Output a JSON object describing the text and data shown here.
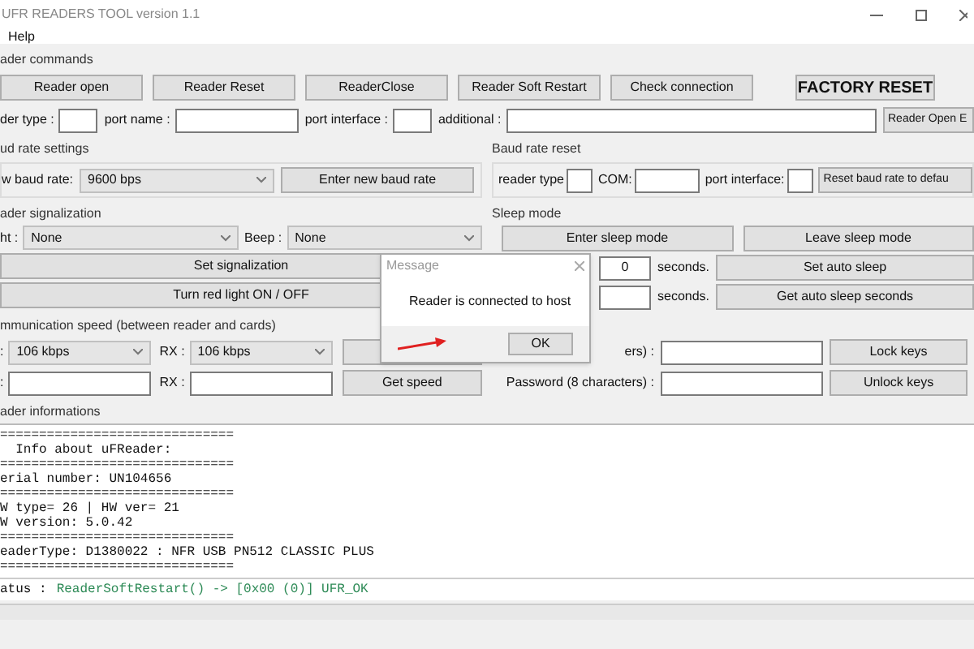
{
  "window": {
    "title": "UFR READERS TOOL version 1.1"
  },
  "menu": [
    "Help"
  ],
  "reader_commands": {
    "title": "ader commands",
    "buttons": [
      {
        "label": "Reader open",
        "kind": "normal"
      },
      {
        "label": "Reader Reset",
        "kind": "normal"
      },
      {
        "label": "ReaderClose",
        "kind": "normal"
      },
      {
        "label": "Reader Soft Restart",
        "kind": "normal"
      },
      {
        "label": "Check connection",
        "kind": "normal"
      },
      {
        "label": "FACTORY RESET",
        "kind": "bold"
      }
    ],
    "fields": [
      {
        "label": "der type :",
        "kind": "small"
      },
      {
        "label": "port name :",
        "kind": "medium"
      },
      {
        "label": "port interface :",
        "kind": "small"
      },
      {
        "label": "additional :",
        "kind": "wide"
      }
    ],
    "open_button": "Reader Open E"
  },
  "baud_settings": {
    "title": "ud rate settings",
    "label": "w baud rate:",
    "value": "9600 bps",
    "button": "Enter new baud rate"
  },
  "baud_reset": {
    "title": "Baud rate reset",
    "fields": [
      {
        "label": "reader type",
        "kind": "small"
      },
      {
        "label": "COM:",
        "kind": "medium"
      },
      {
        "label": "port interface:",
        "kind": "small"
      }
    ],
    "button": "Reset baud rate to defau"
  },
  "signalization": {
    "title": "ader signalization",
    "selects": [
      {
        "label": "ht :",
        "value": "None"
      },
      {
        "label": "Beep :",
        "value": "None"
      }
    ],
    "buttons": [
      "Set signalization",
      "Turn red light ON / OFF"
    ]
  },
  "sleep": {
    "title": "Sleep mode",
    "buttons": [
      "Enter sleep mode",
      "Leave sleep mode"
    ],
    "rows": [
      {
        "value": "0",
        "unit": "seconds.",
        "button": "Set auto sleep"
      },
      {
        "unit": "seconds.",
        "button": "Get auto sleep seconds"
      }
    ]
  },
  "comm_speed": {
    "title": "mmunication speed (between reader and cards)",
    "rows": [
      {
        "kind": "select",
        "tx_label": ":",
        "tx_value": "106 kbps",
        "rx_label": "RX :",
        "rx_value": "106 kbps"
      },
      {
        "kind": "field",
        "tx_label": ":",
        "rx_label": "RX :",
        "button": "Get speed"
      }
    ]
  },
  "keys": {
    "rows": [
      {
        "label": "ers) :",
        "button": "Lock keys"
      },
      {
        "label": "Password (8 characters) :",
        "button": "Unlock keys"
      }
    ]
  },
  "reader_info": {
    "title": "ader informations",
    "lines": [
      "==============================",
      "  Info about uFReader:",
      "==============================",
      "erial number: UN104656",
      "==============================",
      "W type= 26 | HW ver= 21",
      "W version: 5.0.42",
      "==============================",
      "eaderType: D1380022 : NFR USB PN512 CLASSIC PLUS",
      "=============================="
    ],
    "status_label": "atus :",
    "status": "ReaderSoftRestart() -> [0x00 (0)] UFR_OK"
  },
  "dialog": {
    "title": "Message",
    "text": "Reader is connected to host",
    "button": "OK"
  }
}
